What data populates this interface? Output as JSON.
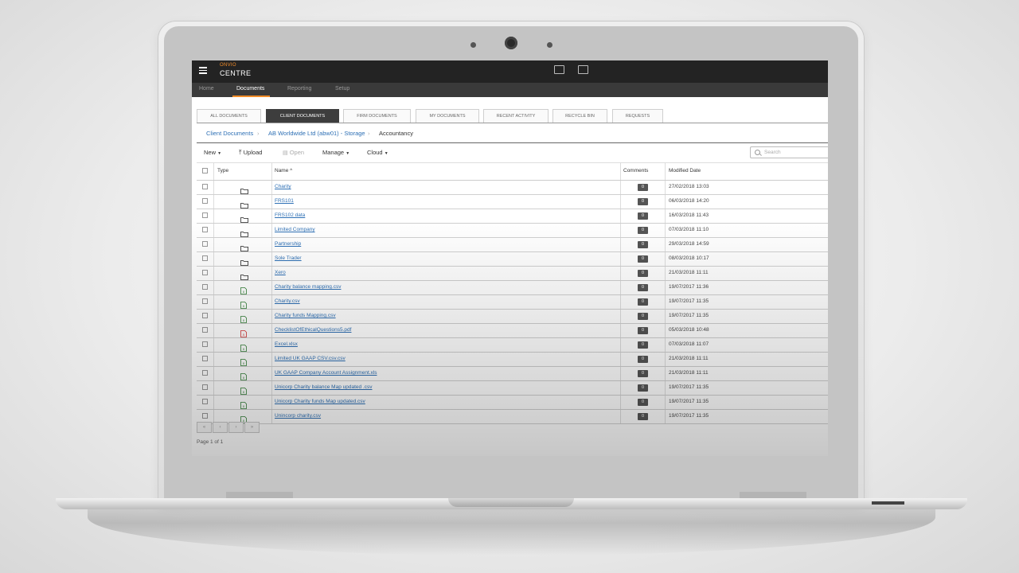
{
  "app": {
    "brand_small": "ONVIO",
    "brand_name": "CENTRE",
    "top_icons": [
      "contact-card-icon",
      "archive-box-icon"
    ]
  },
  "nav": {
    "items": [
      {
        "label": "Home",
        "active": false
      },
      {
        "label": "Documents",
        "active": true
      },
      {
        "label": "Reporting",
        "active": false
      },
      {
        "label": "Setup",
        "active": false
      }
    ]
  },
  "tabs": [
    {
      "label": "ALL DOCUMENTS",
      "active": false
    },
    {
      "label": "CLIENT DOCUMENTS",
      "active": true
    },
    {
      "label": "FIRM DOCUMENTS",
      "active": false
    },
    {
      "label": "MY DOCUMENTS",
      "active": false
    },
    {
      "label": "RECENT ACTIVITY",
      "active": false
    },
    {
      "label": "RECYCLE BIN",
      "active": false
    },
    {
      "label": "REQUESTS",
      "active": false
    }
  ],
  "breadcrumb": [
    "Client Documents",
    "AB Worldwide Ltd (abw01) - Storage",
    "Accountancy"
  ],
  "toolbar": {
    "new": "New",
    "upload": "Upload",
    "open": "Open",
    "manage": "Manage",
    "cloud": "Cloud",
    "search_placeholder": "Search"
  },
  "table": {
    "headers": {
      "type": "Type",
      "name": "Name",
      "comments": "Comments",
      "modified": "Modified Date"
    },
    "sort_indicator": "^",
    "rows": [
      {
        "type": "folder",
        "name": "Charity",
        "comments": "0",
        "modified": "27/02/2018 13:03"
      },
      {
        "type": "folder",
        "name": "FRS101",
        "comments": "0",
        "modified": "06/03/2018 14:20"
      },
      {
        "type": "folder",
        "name": "FRS102 data",
        "comments": "0",
        "modified": "16/03/2018 11:43"
      },
      {
        "type": "folder",
        "name": "Limited Company",
        "comments": "0",
        "modified": "07/03/2018 11:10"
      },
      {
        "type": "folder",
        "name": "Partnership",
        "comments": "0",
        "modified": "29/03/2018 14:59"
      },
      {
        "type": "folder",
        "name": "Sole Trader",
        "comments": "0",
        "modified": "08/03/2018 10:17"
      },
      {
        "type": "folder",
        "name": "Xero",
        "comments": "0",
        "modified": "21/03/2018 11:11"
      },
      {
        "type": "excel",
        "name": "Charity balance mapping.csv",
        "comments": "0",
        "modified": "19/07/2017 11:36"
      },
      {
        "type": "excel",
        "name": "Charity.csv",
        "comments": "0",
        "modified": "19/07/2017 11:35"
      },
      {
        "type": "excel",
        "name": "Charity funds Mapping.csv",
        "comments": "0",
        "modified": "19/07/2017 11:35"
      },
      {
        "type": "pdf",
        "name": "ChecklistOfEthicalQuestions5.pdf",
        "comments": "0",
        "modified": "05/03/2018 10:48"
      },
      {
        "type": "excel",
        "name": "Excel.xlsx",
        "comments": "0",
        "modified": "07/03/2018 11:07"
      },
      {
        "type": "excel",
        "name": "Limited UK GAAP CSV.csv.csv",
        "comments": "0",
        "modified": "21/03/2018 11:11"
      },
      {
        "type": "excel",
        "name": "UK GAAP Company Account Assignment.xls",
        "comments": "0",
        "modified": "21/03/2018 11:11"
      },
      {
        "type": "excel",
        "name": "Unicorp Charity balance Map updated .csv",
        "comments": "0",
        "modified": "19/07/2017 11:35"
      },
      {
        "type": "excel",
        "name": "Unicorp Charity funds Map updated.csv",
        "comments": "0",
        "modified": "19/07/2017 11:35"
      },
      {
        "type": "excel",
        "name": "Unincorp charity.csv",
        "comments": "0",
        "modified": "19/07/2017 11:35"
      }
    ]
  },
  "pagination": {
    "buttons": [
      "«",
      "‹",
      "›",
      "»"
    ],
    "info": "Page 1 of 1"
  },
  "colors": {
    "accent": "#f28c28",
    "link": "#2e70b5",
    "topbar": "#232323",
    "excel": "#2e7d32",
    "pdf": "#d32f2f"
  }
}
